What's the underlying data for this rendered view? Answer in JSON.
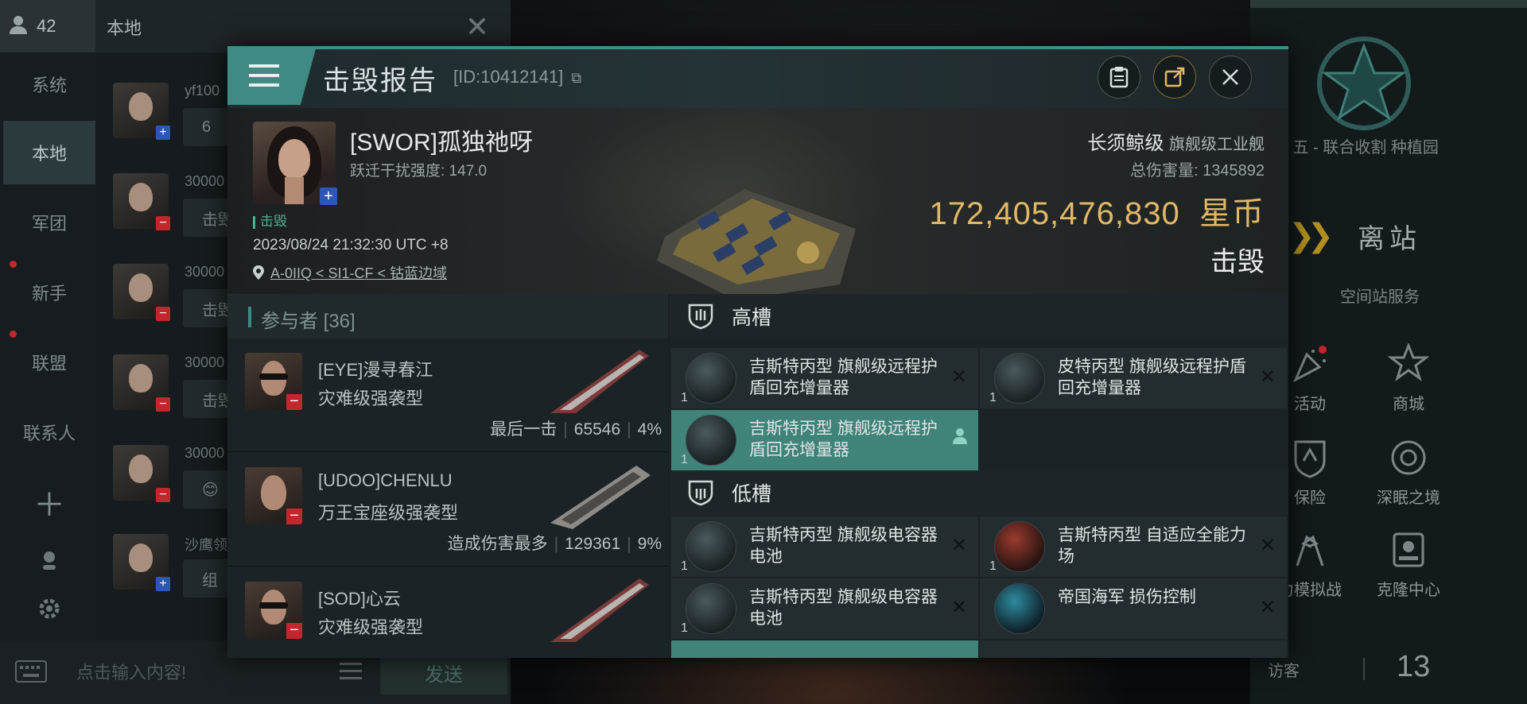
{
  "chat": {
    "online_count": "42",
    "channel": "本地",
    "nav": [
      "系统",
      "本地",
      "军团",
      "新手",
      "联盟",
      "联系人"
    ],
    "messages": [
      {
        "name": "yf100",
        "text": "6",
        "mark": "plus"
      },
      {
        "name": "30000",
        "text": "击毁",
        "mark": "minus"
      },
      {
        "name": "30000",
        "text": "击毁",
        "mark": "minus"
      },
      {
        "name": "30000",
        "text": "击毁",
        "mark": "minus"
      },
      {
        "name": "30000",
        "text": "😊",
        "mark": "minus"
      },
      {
        "name": "沙鹰领",
        "text": "组",
        "mark": "plus"
      }
    ],
    "input_placeholder": "点击输入内容!",
    "send_label": "发送"
  },
  "station": {
    "name": "见 五 - 联合收割 种植园",
    "undock_label": "离站",
    "services_title": "空间站服务",
    "services": [
      {
        "label": "活动",
        "icon": "party-popper-icon"
      },
      {
        "label": "商城",
        "icon": "shop-icon"
      },
      {
        "label": "保险",
        "icon": "insurance-icon"
      },
      {
        "label": "深眠之境",
        "icon": "portal-icon"
      },
      {
        "label": "力模拟战",
        "icon": "flags-icon"
      },
      {
        "label": "克隆中心",
        "icon": "clone-icon"
      }
    ],
    "visitor_label": "访客",
    "visitor_count": "13"
  },
  "report": {
    "title": "击毁报告",
    "id_text": "[ID:10412141]",
    "victim": {
      "name": "[SWOR]孤独祂呀",
      "scram": "跃迁干扰强度: 147.0",
      "tag": "击毁",
      "time": "2023/08/24 21:32:30 UTC +8",
      "location": "A-0IIQ < SI1-CF < 钴蓝边域",
      "ship_name": "长须鲸级",
      "ship_type": "旗舰级工业舰",
      "total_damage_label": "总伤害量: ",
      "total_damage": "1345892",
      "value": "172,405,476,830",
      "value_unit": "星币",
      "result": "击毁"
    },
    "participants_title": "参与者 [36]",
    "participants": [
      {
        "name": "[EYE]漫寻春江",
        "ship": "灾难级强袭型",
        "note": "最后一击",
        "damage": "65546",
        "pct": "4%"
      },
      {
        "name": "[UDOO]CHENLU",
        "ship": "万王宝座级强袭型",
        "note": "造成伤害最多",
        "damage": "129361",
        "pct": "9%"
      },
      {
        "name": "[SOD]心云",
        "ship": "灾难级强袭型",
        "note": "",
        "damage": "",
        "pct": ""
      }
    ],
    "high_slot_label": "高槽",
    "low_slot_label": "低槽",
    "high_modules": [
      {
        "name": "吉斯特丙型 旗舰级远程护盾回充增量器",
        "qty": "1"
      },
      {
        "name": "皮特丙型 旗舰级远程护盾回充增量器",
        "qty": "1"
      },
      {
        "name": "吉斯特丙型 旗舰级远程护盾回充增量器",
        "qty": "1"
      }
    ],
    "low_modules": [
      {
        "name": "吉斯特丙型 旗舰级电容器电池",
        "qty": "1"
      },
      {
        "name": "吉斯特丙型 自适应全能力场",
        "qty": "1"
      },
      {
        "name": "吉斯特丙型 旗舰级电容器电池",
        "qty": "1"
      },
      {
        "name": "帝国海军 损伤控制",
        "qty": ""
      }
    ]
  },
  "colors": {
    "accent": "#3f8a82",
    "isk": "#e2b865",
    "remove": "#c1272d",
    "plus": "#2c57b8"
  }
}
